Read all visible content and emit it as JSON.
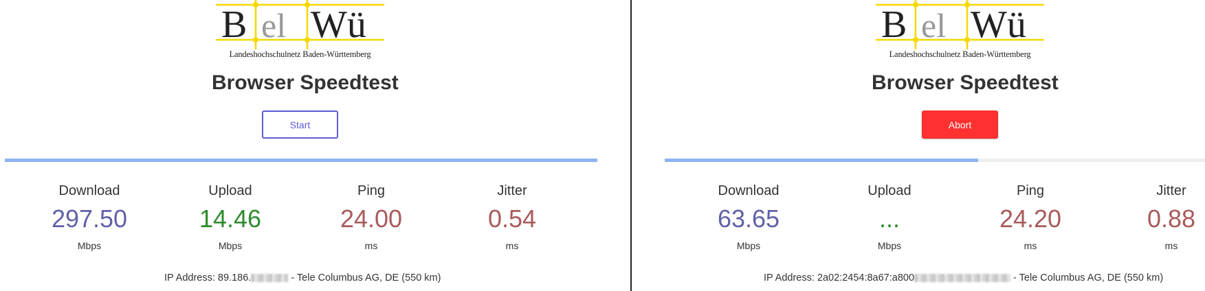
{
  "left": {
    "logo": {
      "tagline": "Landeshochschulnetz Baden-Württemberg"
    },
    "title": "Browser Speedtest",
    "button_label": "Start",
    "progress": 1.0,
    "metrics": {
      "download": {
        "label": "Download",
        "value": "297.50",
        "unit": "Mbps"
      },
      "upload": {
        "label": "Upload",
        "value": "14.46",
        "unit": "Mbps"
      },
      "ping": {
        "label": "Ping",
        "value": "24.00",
        "unit": "ms"
      },
      "jitter": {
        "label": "Jitter",
        "value": "0.54",
        "unit": "ms"
      }
    },
    "ip": {
      "prefix": "IP Address: 89.186.",
      "suffix": " - Tele Columbus AG, DE (550 km)"
    }
  },
  "right": {
    "logo": {
      "tagline": "Landeshochschulnetz Baden-Württemberg"
    },
    "title": "Browser Speedtest",
    "button_label": "Abort",
    "progress": 0.57,
    "metrics": {
      "download": {
        "label": "Download",
        "value": "63.65",
        "unit": "Mbps"
      },
      "upload": {
        "label": "Upload",
        "value": "...",
        "unit": "Mbps"
      },
      "ping": {
        "label": "Ping",
        "value": "24.20",
        "unit": "ms"
      },
      "jitter": {
        "label": "Jitter",
        "value": "0.88",
        "unit": "ms"
      }
    },
    "ip": {
      "prefix": "IP Address: 2a02:2454:8a67:a800",
      "suffix": " - Tele Columbus AG, DE (550 km)"
    }
  },
  "colors": {
    "logo_yellow": "#f5d800",
    "download": "#6060aa",
    "upload": "#2e8b2e",
    "ping": "#aa5a5a",
    "progress": "#8fb4f2",
    "start_border": "#5b5bd6",
    "abort_bg": "#ff3030"
  }
}
